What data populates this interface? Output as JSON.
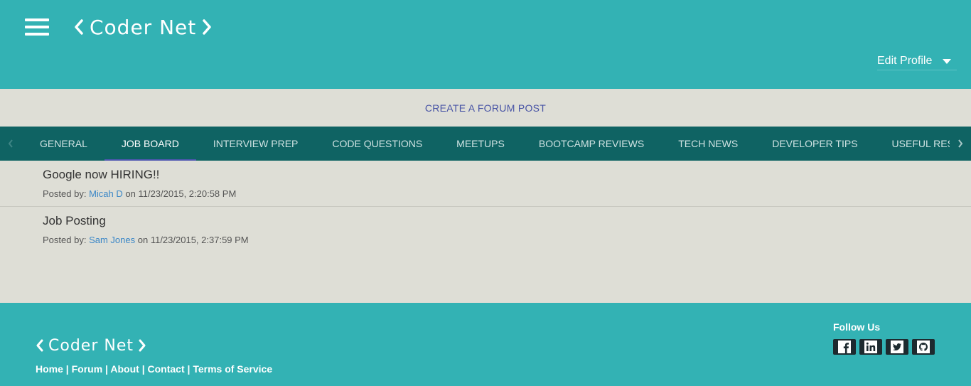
{
  "header": {
    "logo": "Coder Net",
    "edit_profile": "Edit Profile"
  },
  "create_post": "CREATE A FORUM POST",
  "tabs": [
    {
      "label": "GENERAL"
    },
    {
      "label": "JOB BOARD"
    },
    {
      "label": "INTERVIEW PREP"
    },
    {
      "label": "CODE QUESTIONS"
    },
    {
      "label": "MEETUPS"
    },
    {
      "label": "BOOTCAMP REVIEWS"
    },
    {
      "label": "TECH NEWS"
    },
    {
      "label": "DEVELOPER TIPS"
    },
    {
      "label": "USEFUL RES"
    }
  ],
  "active_tab": "JOB BOARD",
  "posts": [
    {
      "title": "Google now HIRING!!",
      "posted_by_label": "Posted by:",
      "author": "Micah D",
      "on_label": "on",
      "timestamp": "11/23/2015, 2:20:58 PM"
    },
    {
      "title": "Job Posting",
      "posted_by_label": "Posted by:",
      "author": "Sam Jones",
      "on_label": "on",
      "timestamp": "11/23/2015, 2:37:59 PM"
    }
  ],
  "footer": {
    "logo": "Coder Net",
    "links": [
      "Home",
      "Forum",
      "About",
      "Contact",
      "Terms of Service"
    ],
    "separator": "|",
    "follow_us": "Follow Us",
    "social_icons": [
      "facebook-icon",
      "linkedin-icon",
      "twitter-icon",
      "github-icon"
    ]
  },
  "colors": {
    "header_bg": "#33b2b4",
    "tabs_bg": "#0f6363",
    "body_bg": "#deded6",
    "link": "#3b87c7",
    "create_link": "#4753a5",
    "active_tab_indicator": "#4d56b0"
  }
}
